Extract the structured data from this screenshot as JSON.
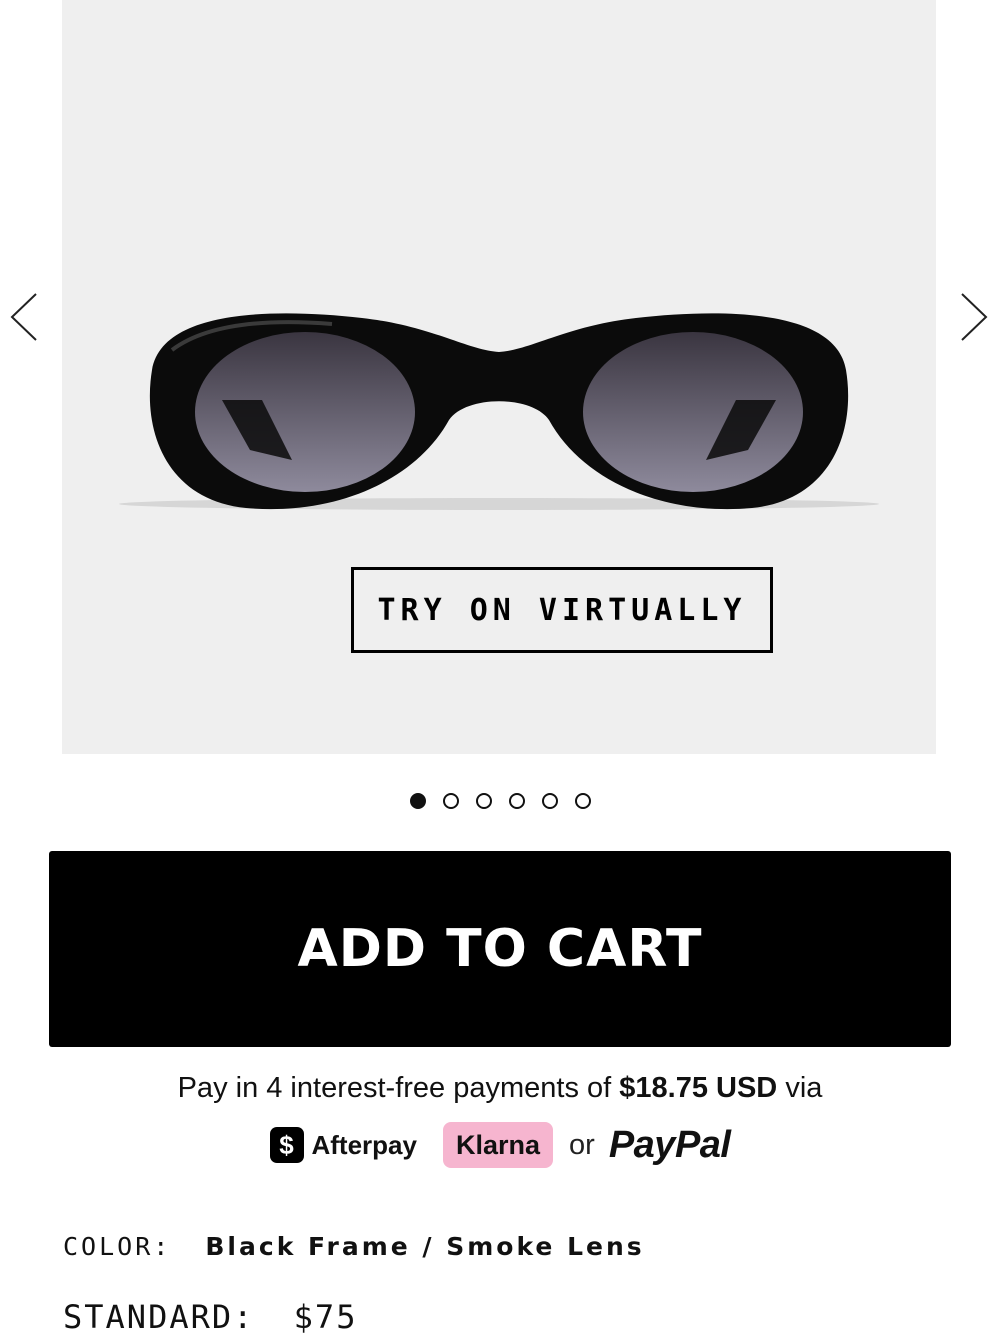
{
  "gallery": {
    "try_on_label": "TRY ON VIRTUALLY",
    "dots": [
      {
        "active": true
      },
      {
        "active": false
      },
      {
        "active": false
      },
      {
        "active": false
      },
      {
        "active": false
      },
      {
        "active": false
      }
    ]
  },
  "cart": {
    "add_label": "ADD TO CART"
  },
  "payment": {
    "prefix": "Pay in 4 interest-free payments of",
    "amount": "$18.75 USD",
    "suffix": "via",
    "afterpay_icon": "$",
    "afterpay_label": "Afterpay",
    "klarna_label": "Klarna",
    "or_label": "or",
    "paypal_label": "PayPal"
  },
  "product": {
    "color_label": "COLOR:",
    "color_value": "Black Frame / Smoke Lens",
    "standard_label": "STANDARD:",
    "standard_price": "$75"
  },
  "colors": {
    "background": "#efefef",
    "button": "#000000",
    "klarna": "#f6b5cf"
  },
  "icons": [
    "chevron-left-icon",
    "chevron-right-icon",
    "afterpay-icon"
  ]
}
